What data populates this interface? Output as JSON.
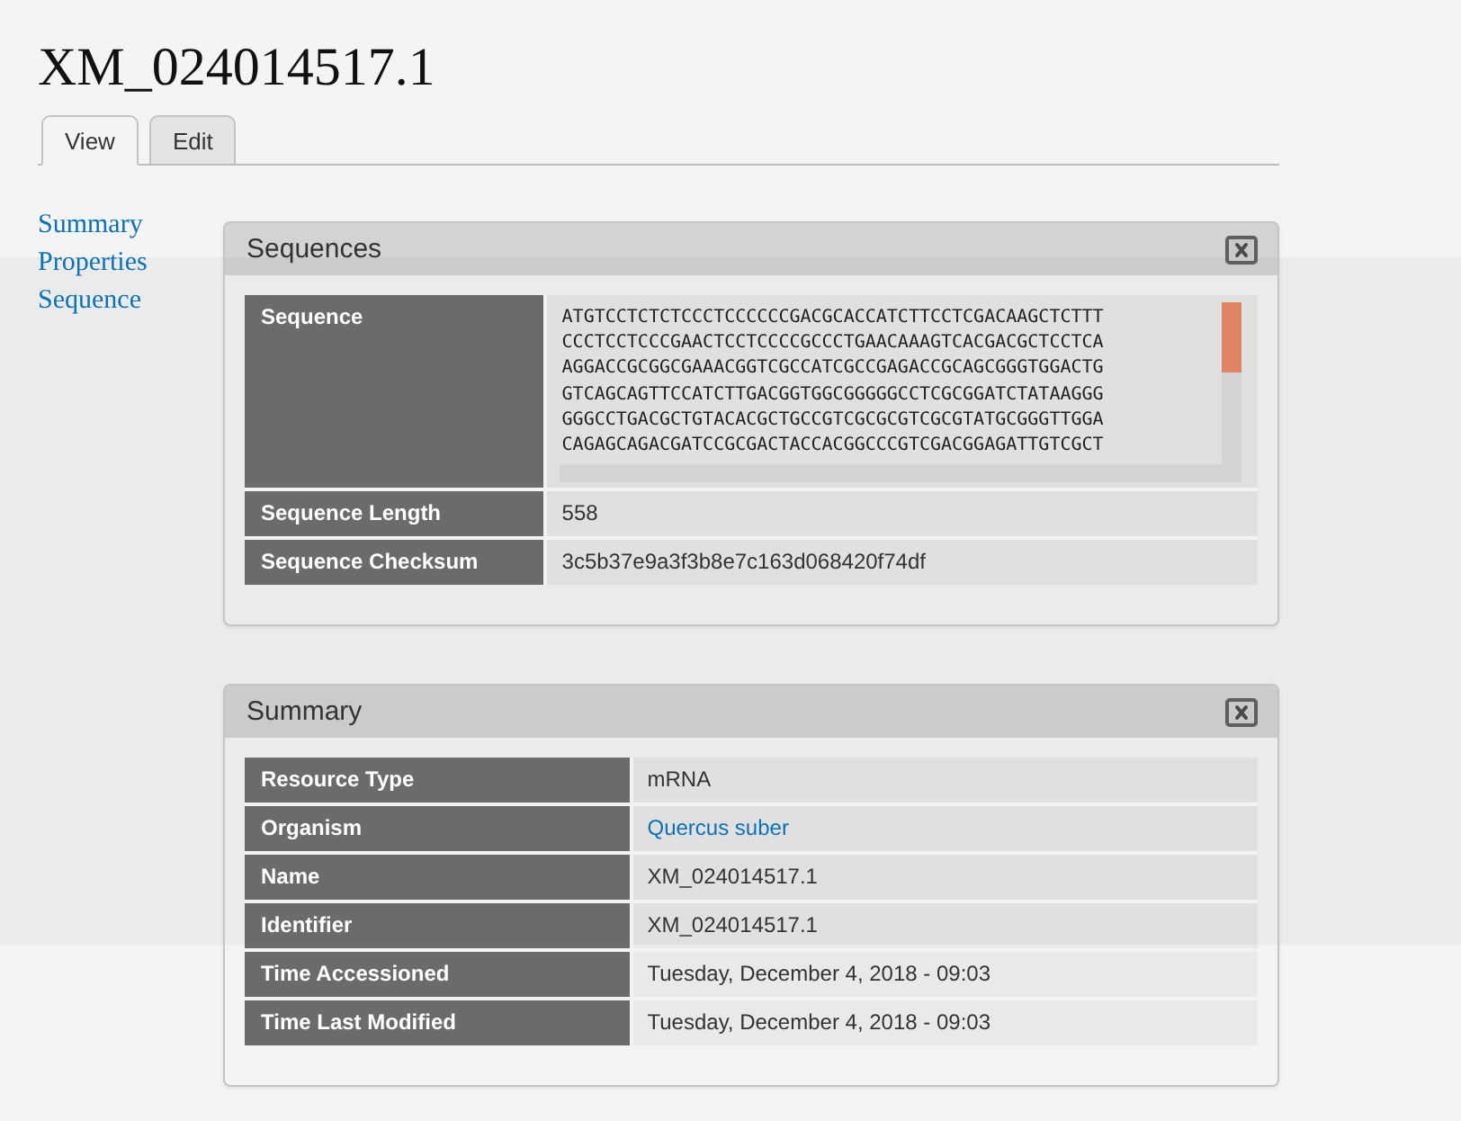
{
  "page": {
    "title": "XM_024014517.1"
  },
  "tabs": [
    {
      "label": "View",
      "selected": true
    },
    {
      "label": "Edit",
      "selected": false
    }
  ],
  "sidebar": {
    "links": [
      "Summary",
      "Properties",
      "Sequence"
    ]
  },
  "panels": [
    {
      "title": "Sequences",
      "rows": [
        {
          "label": "Sequence",
          "kind": "sequence",
          "lines": [
            "ATGTCCTCTCTCCCTCCCCCCGACGCACCATCTTCCTCGACAAGCTCTTT",
            "CCCTCCTCCCGAACTCCTCCCCGCCCTGAACAAAGTCACGACGCTCCTCA",
            "AGGACCGCGGCGAAACGGTCGCCATCGCCGAGACCGCAGCGGGTGGACTG",
            "GTCAGCAGTTCCATCTTGACGGTGGCGGGGGCCTCGCGGATCTATAAGGG",
            "GGGCCTGACGCTGTACACGCTGCCGTCGCGCGTCGCGTATGCGGGTTGGA",
            "CAGAGCAGACGATCCGCGACTACCACGGCCCGTCGACGGAGATTGTCGCT"
          ]
        },
        {
          "label": "Sequence Length",
          "kind": "text",
          "value": "558"
        },
        {
          "label": "Sequence Checksum",
          "kind": "text",
          "value": "3c5b37e9a3f3b8e7c163d068420f74df"
        }
      ]
    },
    {
      "title": "Summary",
      "rows": [
        {
          "label": "Resource Type",
          "kind": "text",
          "value": "mRNA"
        },
        {
          "label": "Organism",
          "kind": "link",
          "value": "Quercus suber"
        },
        {
          "label": "Name",
          "kind": "text",
          "value": "XM_024014517.1"
        },
        {
          "label": "Identifier",
          "kind": "text",
          "value": "XM_024014517.1"
        },
        {
          "label": "Time Accessioned",
          "kind": "text",
          "value": "Tuesday, December 4, 2018 - 09:03"
        },
        {
          "label": "Time Last Modified",
          "kind": "text",
          "value": "Tuesday, December 4, 2018 - 09:03"
        }
      ]
    }
  ]
}
